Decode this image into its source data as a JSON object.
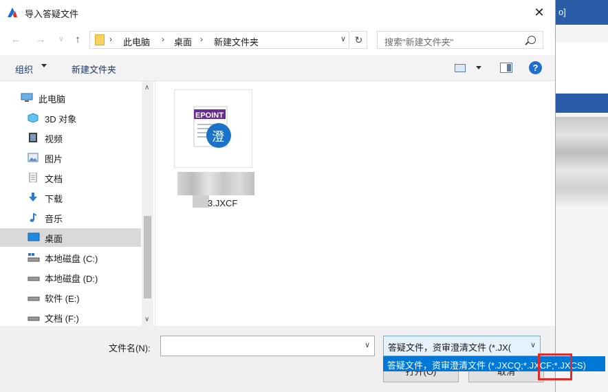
{
  "background_app": {
    "header_fragment": "o]"
  },
  "window": {
    "title": "导入答疑文件"
  },
  "nav": {
    "breadcrumbs": [
      "此电脑",
      "桌面",
      "新建文件夹"
    ],
    "search_placeholder": "搜索\"新建文件夹\""
  },
  "toolbar": {
    "organize": "组织",
    "new_folder": "新建文件夹"
  },
  "sidebar": {
    "items": [
      {
        "label": "此电脑",
        "icon": "pc-icon"
      },
      {
        "label": "3D 对象",
        "icon": "3d-objects-icon"
      },
      {
        "label": "视频",
        "icon": "video-icon"
      },
      {
        "label": "图片",
        "icon": "pictures-icon"
      },
      {
        "label": "文档",
        "icon": "documents-icon"
      },
      {
        "label": "下载",
        "icon": "download-icon"
      },
      {
        "label": "音乐",
        "icon": "music-icon"
      },
      {
        "label": "桌面",
        "icon": "desktop-icon",
        "selected": true
      },
      {
        "label": "本地磁盘 (C:)",
        "icon": "system-drive-icon"
      },
      {
        "label": "本地磁盘 (D:)",
        "icon": "drive-icon"
      },
      {
        "label": "软件 (E:)",
        "icon": "drive-icon"
      },
      {
        "label": "文档 (F:)",
        "icon": "drive-icon"
      }
    ]
  },
  "files": [
    {
      "badge": "EPOINT",
      "glyph": "澄",
      "name_visible": "3.JXCF"
    }
  ],
  "bottom": {
    "filename_label": "文件名(N):",
    "filename_value": "",
    "filter_selected": "答疑文件，资审澄清文件 (*.JX(",
    "filter_options": [
      "答疑文件，资审澄清文件 (*.JXCQ;*.JXCF;*.JXCS)"
    ],
    "open_label": "打开(O)",
    "cancel_label": "取消"
  },
  "colors": {
    "accent": "#0078d7",
    "highlight": "#e02b2b",
    "epoint_purple": "#6b2c91",
    "epoint_blue": "#1b73c9"
  }
}
